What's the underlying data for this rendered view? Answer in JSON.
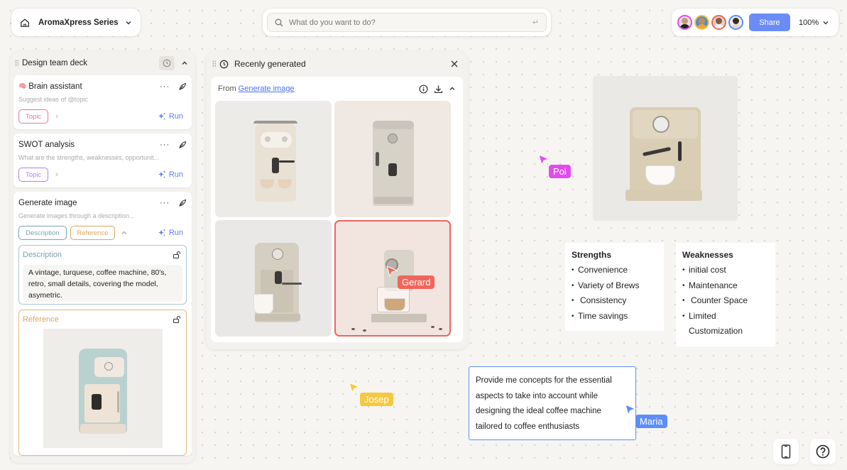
{
  "project": {
    "name": "AromaXpress Series",
    "icon": "home-icon"
  },
  "search": {
    "placeholder": "What do you want to do?",
    "enter_hint": "↵"
  },
  "collaboration": {
    "avatars": [
      {
        "name": "Pol",
        "ring_color": "#e14cf0"
      },
      {
        "name": "Josep",
        "ring_color": "#f5c83f"
      },
      {
        "name": "Gerard",
        "ring_color": "#f0665a"
      },
      {
        "name": "Maria",
        "ring_color": "#5d8ef5"
      }
    ],
    "share_label": "Share",
    "zoom_level": "100%"
  },
  "deck": {
    "title": "Design team deck",
    "cards": [
      {
        "title": "Brain assistant",
        "emoji": "🧠",
        "subtitle": "Suggest ideas of @topic",
        "chips": [
          {
            "label": "Topic",
            "color": "#e07a95"
          }
        ],
        "run_label": "Run"
      },
      {
        "title": "SWOT analysis",
        "subtitle": "What are the strengths, weaknesses, opportunit...",
        "chips": [
          {
            "label": "Topic",
            "color": "#b380e6"
          }
        ],
        "run_label": "Run"
      },
      {
        "title": "Generate image",
        "subtitle": "Generate images through a description...",
        "chips": [
          {
            "label": "Description",
            "color": "#7aa3b3"
          },
          {
            "label": "Reference",
            "color": "#e0a45a"
          }
        ],
        "run_label": "Run",
        "description_field": {
          "label": "Description",
          "value": "A vintage, turquese, coffee machine, 80's, retro, small details, covering the model, asymetric."
        },
        "reference_field": {
          "label": "Reference"
        }
      }
    ]
  },
  "recent": {
    "title": "Recenly generated",
    "from_label": "From",
    "from_link": "Generate image",
    "images": [
      {
        "alt": "Cream retro espresso machine with two cups"
      },
      {
        "alt": "Stainless espresso machine with dial"
      },
      {
        "alt": "Beige espresso machine with one cup"
      },
      {
        "alt": "Vintage espresso machine with coffee beans",
        "selected": true
      }
    ]
  },
  "swot": {
    "strengths": {
      "title": "Strengths",
      "items": [
        "Convenience",
        "Variety of Brews",
        "Consistency",
        "Time savings"
      ]
    },
    "weaknesses": {
      "title": "Weaknesses",
      "items": [
        "initial cost",
        "Maintenance",
        "Counter Space",
        "Limited Customization"
      ]
    }
  },
  "prompt_note": {
    "text": "Provide me concepts for the essential aspects to take into account while designing the ideal coffee machine tailored to coffee enthusiasts"
  },
  "cursors": [
    {
      "name": "Pol",
      "color": "#e14cf0"
    },
    {
      "name": "Josep",
      "color": "#f5c83f"
    },
    {
      "name": "Gerard",
      "color": "#f0665a"
    },
    {
      "name": "Maria",
      "color": "#5d8ef5"
    }
  ],
  "corner_buttons": {
    "device": "mobile-icon",
    "help": "help-icon"
  }
}
